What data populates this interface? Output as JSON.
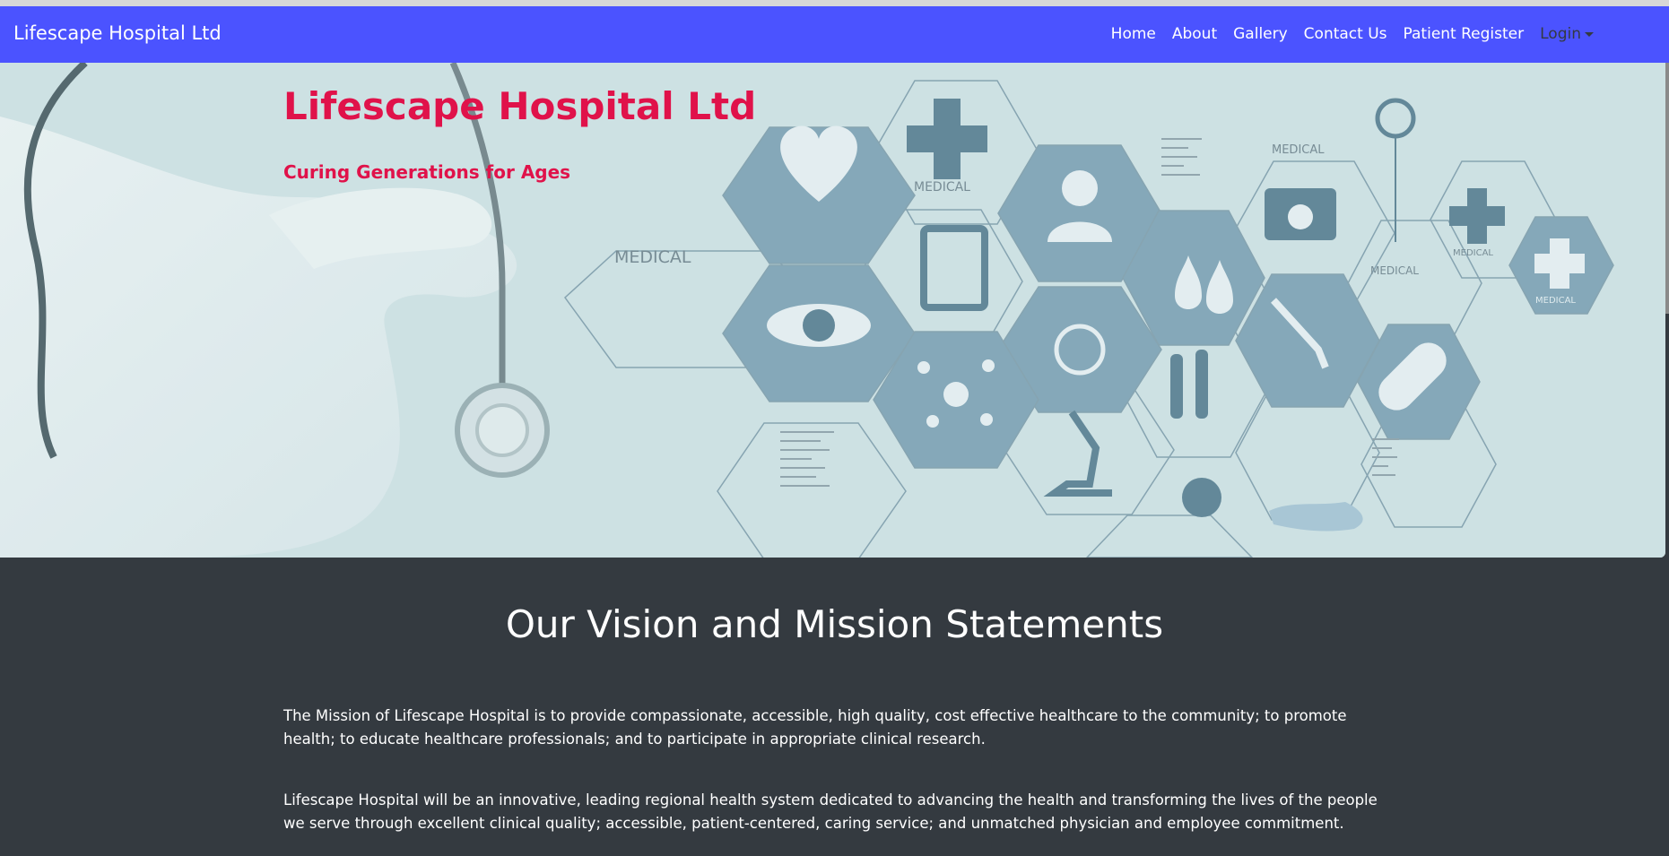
{
  "navbar": {
    "brand": "Lifescape Hospital Ltd",
    "links": [
      "Home",
      "About",
      "Gallery",
      "Contact Us",
      "Patient Register"
    ],
    "login_label": "Login",
    "color": "#4b53ff"
  },
  "hero": {
    "title": "Lifescape Hospital Ltd",
    "subtitle": "Curing Generations for Ages",
    "title_color": "#e0124a",
    "image_words": [
      "MEDICAL",
      "MEDICAL",
      "MEDICAL",
      "MEDICAL",
      "MEDICAL",
      "MEDICAL"
    ]
  },
  "mission": {
    "heading": "Our Vision and Mission Statements",
    "paragraph1": "The Mission of Lifescape Hospital is to provide compassionate, accessible, high quality, cost effective healthcare to the community; to promote health; to educate healthcare professionals; and to participate in appropriate clinical research.",
    "paragraph2": "Lifescape Hospital will be an innovative, leading regional health system dedicated to advancing the health and transforming the lives of the people we serve through excellent clinical quality; accessible, patient-centered, caring service; and unmatched physician and employee commitment."
  }
}
